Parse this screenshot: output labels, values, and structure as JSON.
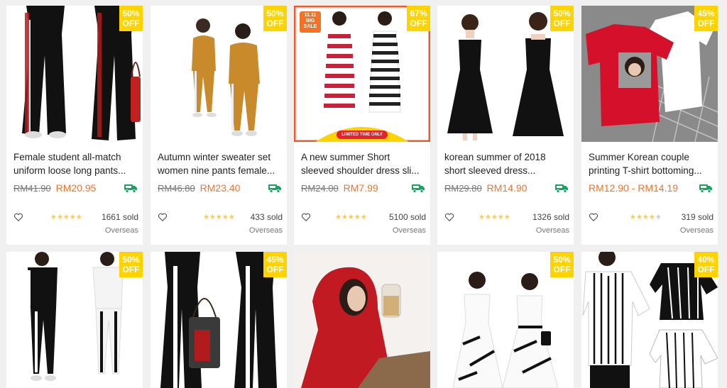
{
  "products": [
    {
      "discount": "50%",
      "off": "OFF",
      "title_line1": "Female student all-match",
      "title_line2": "uniform loose long pants...",
      "old_price": "RM41.90",
      "price": "RM20.95",
      "rating": "4.5",
      "sold": "1661 sold",
      "shipping": "Overseas",
      "colors": {
        "bg": "#ffffff",
        "main": "#111111",
        "accent": "#ffffff"
      }
    },
    {
      "discount": "50%",
      "off": "OFF",
      "title_line1": "Autumn winter sweater set",
      "title_line2": "women nine pants female...",
      "old_price": "RM46.80",
      "price": "RM23.40",
      "rating": "4.5",
      "sold": "433 sold",
      "shipping": "Overseas",
      "colors": {
        "bg": "#ffffff",
        "main": "#c98a2c",
        "accent": "#eeeeee"
      }
    },
    {
      "discount": "67%",
      "off": "OFF",
      "title_line1": "A new summer Short",
      "title_line2": "sleeved shoulder dress sli...",
      "old_price": "RM24.00",
      "price": "RM7.99",
      "rating": "5",
      "sold": "5100 sold",
      "shipping": "Overseas",
      "promo_text": "11.11 BIG SALE",
      "promo_banner": "LIMITED TIME ONLY",
      "colors": {
        "bg": "#ffffff",
        "main": "#c8223a",
        "accent": "#222222"
      }
    },
    {
      "discount": "50%",
      "off": "OFF",
      "title_line1": "korean summer of 2018",
      "title_line2": "short sleeved dress...",
      "old_price": "RM29.80",
      "price": "RM14.90",
      "rating": "4.5",
      "sold": "1326 sold",
      "shipping": "Overseas",
      "colors": {
        "bg": "#ffffff",
        "main": "#111111",
        "accent": "#f0d0c0"
      }
    },
    {
      "discount": "45%",
      "off": "OFF",
      "title_line1": "Summer Korean couple",
      "title_line2": "printing T-shirt bottoming...",
      "price_range": "RM12.90 - RM14.19",
      "rating": "4",
      "sold": "319 sold",
      "shipping": "Overseas",
      "colors": {
        "bg": "#888888",
        "main": "#d5102a",
        "accent": "#ffffff"
      }
    },
    {
      "discount": "50%",
      "off": "OFF",
      "colors": {
        "bg": "#ffffff",
        "main": "#111111",
        "accent": "#ffffff"
      }
    },
    {
      "discount": "45%",
      "off": "OFF",
      "colors": {
        "bg": "#ffffff",
        "main": "#111111",
        "accent": "#ffffff"
      }
    },
    {
      "colors": {
        "bg": "#f4f1ee",
        "main": "#c11a22",
        "accent": "#8a6a4a"
      }
    },
    {
      "discount": "50%",
      "off": "OFF",
      "colors": {
        "bg": "#ffffff",
        "main": "#ffffff",
        "accent": "#111111"
      }
    },
    {
      "discount": "40%",
      "off": "OFF",
      "colors": {
        "bg": "#ffffff",
        "main": "#ffffff",
        "accent": "#111111"
      }
    }
  ],
  "icons": {
    "wishlist": "heart-outline-icon",
    "shipping": "free-shipping-truck-icon",
    "rating": "star-icon"
  },
  "accent_colors": {
    "badge": "#ffd300",
    "price": "#f57224",
    "star": "#faca51",
    "free_shipping": "#1aa260"
  }
}
